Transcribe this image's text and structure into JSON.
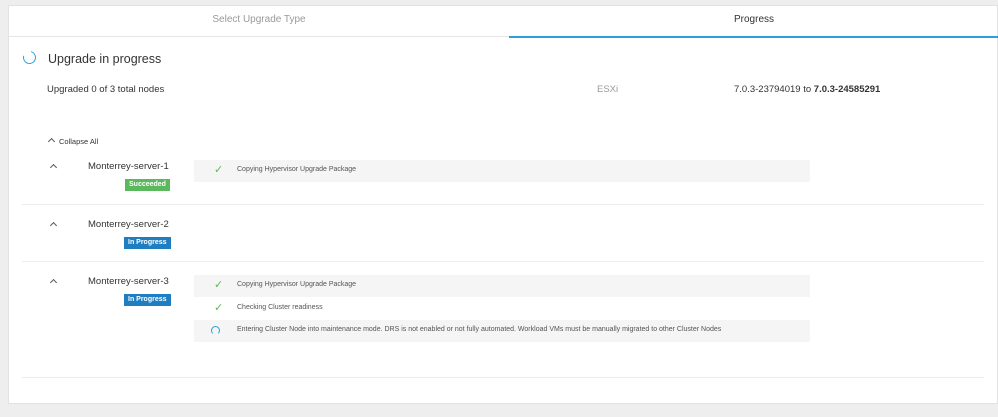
{
  "tabs": [
    {
      "label": "Select Upgrade Type"
    },
    {
      "label": "Progress"
    }
  ],
  "header": {
    "title": "Upgrade in progress",
    "summary": "Upgraded 0 of 3 total nodes",
    "component": "ESXi",
    "from_version": "7.0.3-23794019",
    "to_word": "to",
    "to_version": "7.0.3-24585291"
  },
  "collapse_all_label": "Collapse All",
  "nodes": [
    {
      "name": "Monterrey-server-1",
      "status": "Succeeded",
      "steps": [
        {
          "icon": "check-icon",
          "text": "Copying Hypervisor Upgrade Package"
        }
      ]
    },
    {
      "name": "Monterrey-server-2",
      "status": "In Progress",
      "steps": []
    },
    {
      "name": "Monterrey-server-3",
      "status": "In Progress",
      "steps": [
        {
          "icon": "check-icon",
          "text": "Copying Hypervisor Upgrade Package"
        },
        {
          "icon": "check-icon",
          "text": "Checking Cluster readiness"
        },
        {
          "icon": "spinner-icon",
          "text": "Entering Cluster Node into maintenance mode. DRS is not enabled or not fully automated. Workload VMs must be manually migrated to other Cluster Nodes"
        }
      ]
    }
  ],
  "colors": {
    "accent": "#2d9fd8",
    "success": "#5cb85c",
    "in_progress": "#1f7ec1"
  }
}
